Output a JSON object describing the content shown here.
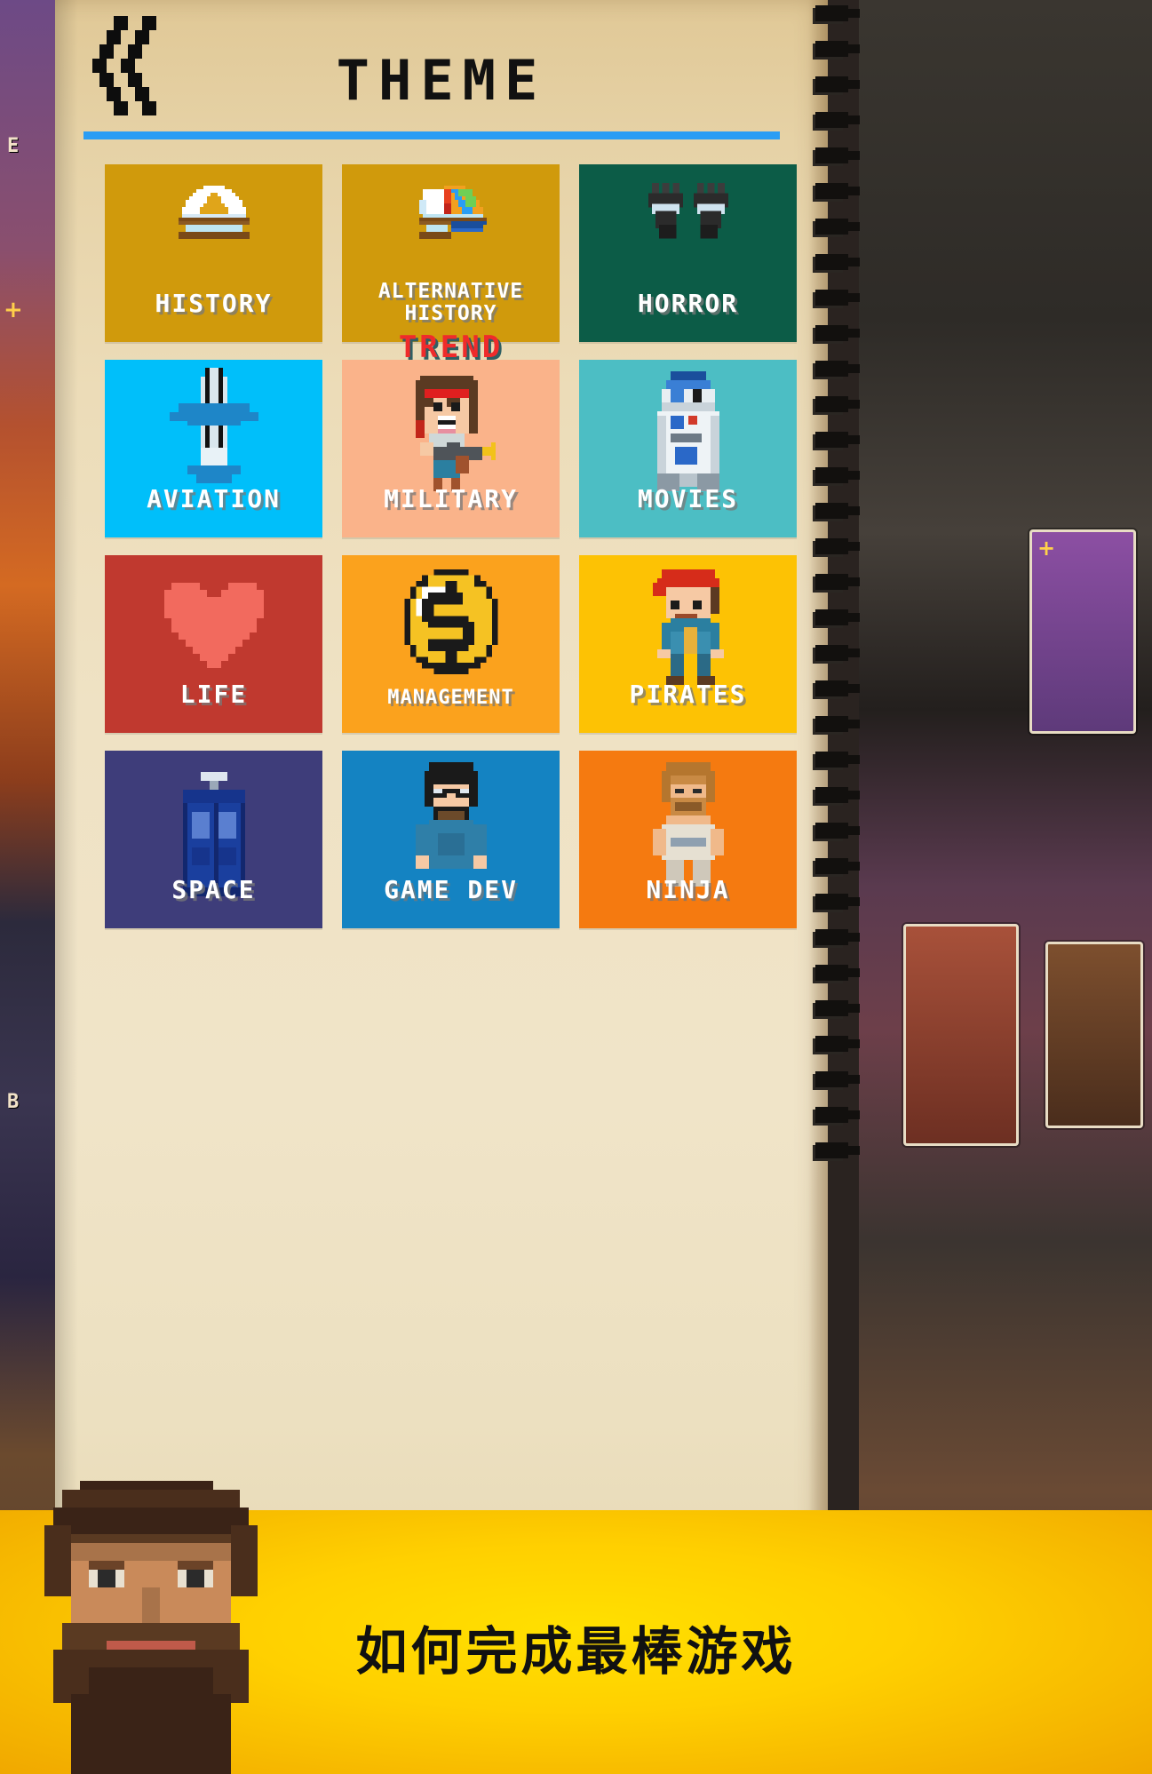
{
  "header": {
    "title": "THEME",
    "back_icon": "double-chevron-left-icon",
    "rule_color": "#2a9df4"
  },
  "page": {
    "background_color": "#efe2c4",
    "binding": "spiral-binding"
  },
  "themes": [
    {
      "id": "history",
      "label": "HISTORY",
      "color": "#d09a0c",
      "icon": "snow-mountain-book-icon",
      "badge": null,
      "label_lines": 1
    },
    {
      "id": "alternative-history",
      "label": "ALTERNATIVE\nHISTORY",
      "color": "#d09a0c",
      "icon": "rainbow-book-icon",
      "badge": null,
      "label_lines": 2
    },
    {
      "id": "horror",
      "label": "HORROR",
      "color": "#0c5c47",
      "icon": "zombie-hands-icon",
      "badge": null,
      "label_lines": 1
    },
    {
      "id": "aviation",
      "label": "AVIATION",
      "color": "#00bffa",
      "icon": "airplane-icon",
      "badge": null,
      "label_lines": 1
    },
    {
      "id": "military",
      "label": "MILITARY",
      "color": "#fab38a",
      "icon": "soldier-rambo-icon",
      "badge": "TREND",
      "label_lines": 1
    },
    {
      "id": "movies",
      "label": "MOVIES",
      "color": "#4cbec4",
      "icon": "droid-robot-icon",
      "badge": null,
      "label_lines": 1
    },
    {
      "id": "life",
      "label": "LIFE",
      "color": "#c0392f",
      "icon": "heart-icon",
      "badge": null,
      "label_lines": 1
    },
    {
      "id": "management",
      "label": "MANAGEMENT",
      "color": "#fba21d",
      "icon": "dollar-coin-icon",
      "badge": null,
      "label_lines": 1
    },
    {
      "id": "pirates",
      "label": "PIRATES",
      "color": "#fdc204",
      "icon": "pirate-character-icon",
      "badge": null,
      "label_lines": 1
    },
    {
      "id": "space",
      "label": "SPACE",
      "color": "#3e3d7a",
      "icon": "police-box-icon",
      "badge": null,
      "label_lines": 1
    },
    {
      "id": "game-dev",
      "label": "GAME DEV",
      "color": "#1483c2",
      "icon": "developer-character-icon",
      "badge": null,
      "label_lines": 1
    },
    {
      "id": "ninja",
      "label": "NINJA",
      "color": "#f57a10",
      "icon": "ninja-character-icon",
      "badge": null,
      "label_lines": 1
    }
  ],
  "banner": {
    "text": "如何完成最棒游戏",
    "background_color": "#ffd000",
    "mascot": "bearded-man-avatar"
  },
  "background_scene": {
    "left_labels": [
      "E",
      "B"
    ],
    "plus_markers": [
      "+",
      "+"
    ]
  }
}
